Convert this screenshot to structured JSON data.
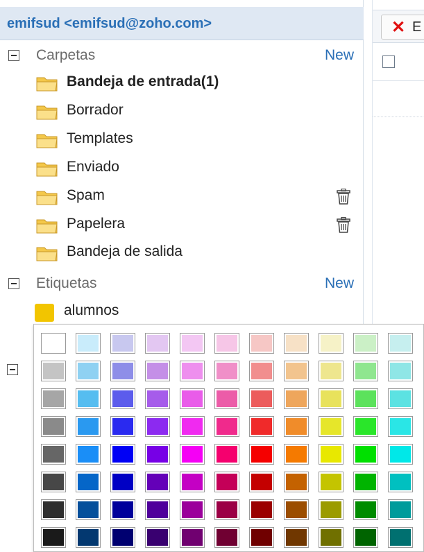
{
  "sidebar": {
    "account": "emifsud <emifsud@zoho.com>",
    "folders_section": {
      "label": "Carpetas",
      "new": "New"
    },
    "folders": [
      {
        "label": "Bandeja de entrada(1)",
        "bold": true,
        "trash": false
      },
      {
        "label": "Borrador",
        "bold": false,
        "trash": false
      },
      {
        "label": "Templates",
        "bold": false,
        "trash": false
      },
      {
        "label": "Enviado",
        "bold": false,
        "trash": false
      },
      {
        "label": "Spam",
        "bold": false,
        "trash": true
      },
      {
        "label": "Papelera",
        "bold": false,
        "trash": true
      },
      {
        "label": "Bandeja de salida",
        "bold": false,
        "trash": false
      }
    ],
    "tags_section": {
      "label": "Etiquetas",
      "new": "New"
    },
    "tags": [
      {
        "label": "alumnos",
        "color": "#f2c500"
      }
    ]
  },
  "toolbar": {
    "delete_label": "E",
    "delete_icon": "✕"
  },
  "palette": {
    "colors": [
      [
        "#ffffff",
        "#c9ecfb",
        "#c8c8ef",
        "#e3c7f2",
        "#f3c7f3",
        "#f6c6e7",
        "#f6c7c5",
        "#f7e1c6",
        "#f6f2c7",
        "#cbf0c6",
        "#c6efef"
      ],
      [
        "#c4c4c4",
        "#8fd1f2",
        "#8e8ee8",
        "#c48fe7",
        "#ee8fee",
        "#f08fc8",
        "#f18e8e",
        "#f2c48e",
        "#eee68e",
        "#8fe68f",
        "#8fe6e6"
      ],
      [
        "#a6a6a6",
        "#56bdf0",
        "#5c5cec",
        "#a65cea",
        "#e95ce9",
        "#ec5ca8",
        "#ec5c5c",
        "#eea65c",
        "#e8e25c",
        "#5ce25c",
        "#5ce2e2"
      ],
      [
        "#8a8a8a",
        "#2a99f0",
        "#2a2af0",
        "#8c2af0",
        "#f02af0",
        "#f02a8c",
        "#f02a2a",
        "#f08c2a",
        "#e6e62a",
        "#2ae62a",
        "#2ae6e6"
      ],
      [
        "#666666",
        "#1a8ef7",
        "#0000f5",
        "#7700e6",
        "#f500f5",
        "#f5006e",
        "#f50000",
        "#f57a00",
        "#e8e800",
        "#00e000",
        "#00e8e8"
      ],
      [
        "#474747",
        "#0566c8",
        "#0000c4",
        "#6400b8",
        "#c400c4",
        "#c40058",
        "#c40000",
        "#c46200",
        "#c4c400",
        "#00b400",
        "#00c0c0"
      ],
      [
        "#2e2e2e",
        "#044f9b",
        "#00009b",
        "#4f009b",
        "#9b009b",
        "#9b0045",
        "#9b0000",
        "#9b4d00",
        "#9b9b00",
        "#008c00",
        "#009b9b"
      ],
      [
        "#1a1a1a",
        "#033870",
        "#000070",
        "#390070",
        "#700070",
        "#700032",
        "#700000",
        "#703700",
        "#707000",
        "#006400",
        "#007070"
      ]
    ]
  }
}
